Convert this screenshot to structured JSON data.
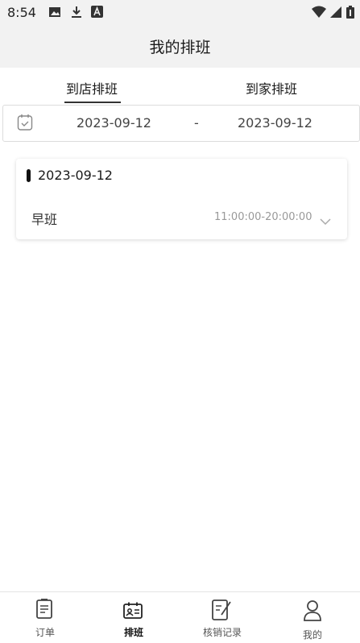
{
  "status_bar": {
    "time": "8:54",
    "icons": [
      "image-icon",
      "download-icon",
      "a-app-icon",
      "wifi-icon",
      "signal-icon",
      "battery-icon"
    ]
  },
  "header": {
    "title": "我的排班"
  },
  "tabs": [
    {
      "label": "到店排班",
      "active": true
    },
    {
      "label": "到家排班",
      "active": false
    }
  ],
  "date_range": {
    "icon": "calendar-check-icon",
    "start": "2023-09-12",
    "separator": "-",
    "end": "2023-09-12"
  },
  "schedule": [
    {
      "date": "2023-09-12",
      "shift_name": "早班",
      "shift_time": "11:00:00-20:00:00",
      "expand_icon": "chevron-down-icon"
    }
  ],
  "bottom_nav": [
    {
      "label": "订单",
      "icon": "order-icon",
      "active": false
    },
    {
      "label": "排班",
      "icon": "schedule-icon",
      "active": true
    },
    {
      "label": "核销记录",
      "icon": "writeoff-record-icon",
      "active": false
    },
    {
      "label": "我的",
      "icon": "profile-icon",
      "active": false
    }
  ],
  "colors": {
    "accent": "#111111",
    "header_bg": "#f2f2f2",
    "muted_text": "#999999"
  }
}
